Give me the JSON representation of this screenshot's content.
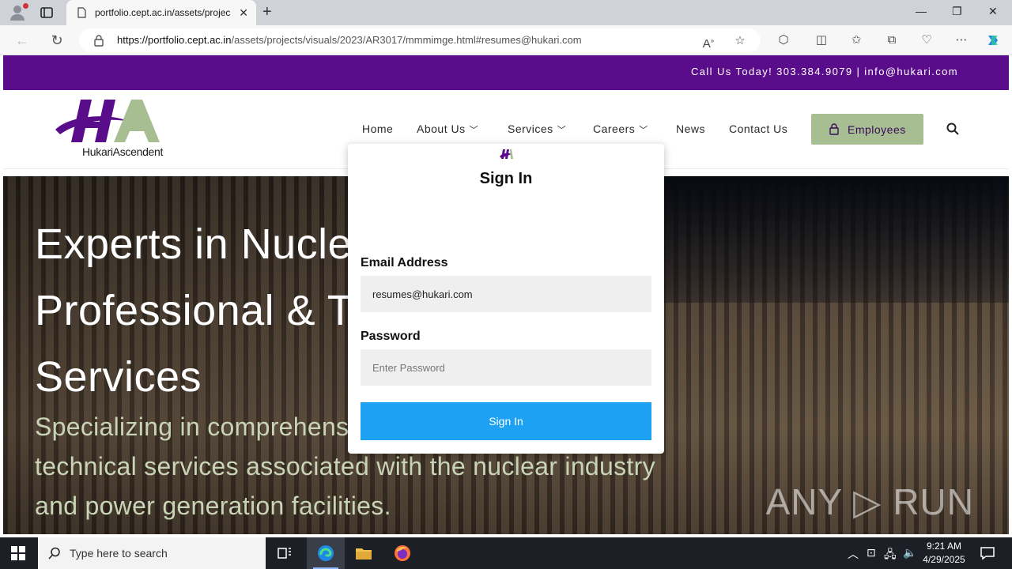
{
  "browser": {
    "tab_title": "portfolio.cept.ac.in/assets/projec",
    "url_host": "https://portfolio.cept.ac.in",
    "url_path": "/assets/projects/visuals/2023/AR3017/mmmimge.html#resumes@hukari.com",
    "icons": [
      "profile-icon",
      "tabs-icon",
      "back-icon",
      "refresh-icon",
      "lock-icon",
      "read-aloud-icon",
      "favorite-icon",
      "extensions-icon",
      "split-screen-icon",
      "favorites-icon",
      "collections-icon",
      "performance-icon",
      "more-icon",
      "copilot-icon"
    ]
  },
  "site": {
    "contact_strip": "Call Us Today!  303.384.9079 | info@hukari.com",
    "logo_text": "HukariAscendent",
    "nav": [
      {
        "label": "Home",
        "dropdown": false
      },
      {
        "label": "About Us",
        "dropdown": true
      },
      {
        "label": "Services",
        "dropdown": true
      },
      {
        "label": "Careers",
        "dropdown": true
      },
      {
        "label": "News",
        "dropdown": false
      },
      {
        "label": "Contact Us",
        "dropdown": false
      }
    ],
    "employees_button": "Employees",
    "hero_title": "Experts in Nuclear Professional & Technical Services",
    "hero_subtitle": "Specializing in comprehensive professional and technical services associated with the nuclear industry and power generation facilities.",
    "watermark": "ANY ▷ RUN",
    "colors": {
      "strip": "#5a0d8a",
      "employees_bg": "#a7bd92",
      "subtitle": "#c9d4b6"
    }
  },
  "modal": {
    "title": "Sign In",
    "email_label": "Email Address",
    "email_value": "resumes@hukari.com",
    "password_label": "Password",
    "password_placeholder": "Enter Password",
    "submit_label": "Sign In",
    "submit_color": "#1da1f2"
  },
  "taskbar": {
    "search_placeholder": "Type here to search",
    "time": "9:21 AM",
    "date": "4/29/2025"
  }
}
